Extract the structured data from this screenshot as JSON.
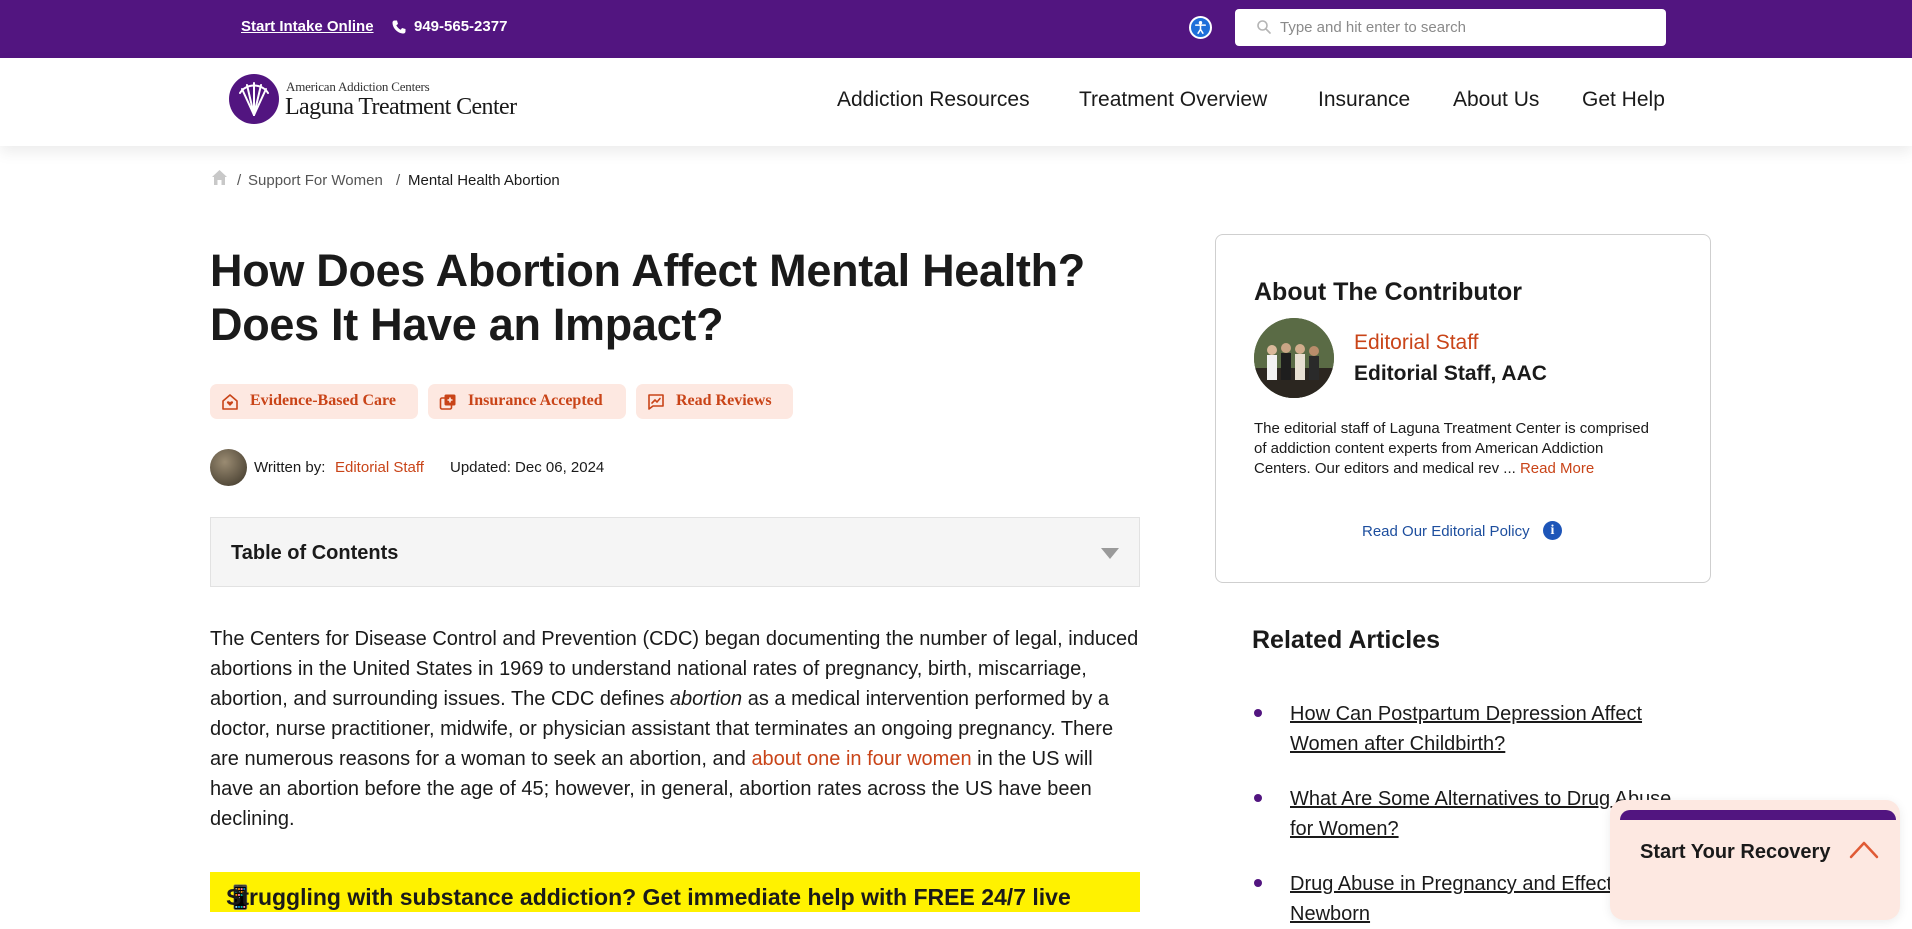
{
  "topbar": {
    "intake_label": "Start Intake Online",
    "phone": "949-565-2377",
    "search_placeholder": "Type and hit enter to search",
    "bg_color": "#521580"
  },
  "header": {
    "logo_top": "American Addiction Centers",
    "logo_main": "Laguna Treatment Center",
    "nav": [
      "Addiction Resources",
      "Treatment Overview",
      "Insurance",
      "About Us",
      "Get Help"
    ]
  },
  "breadcrumb": {
    "items": [
      "Support For Women",
      "Mental Health Abortion"
    ],
    "separator": "/"
  },
  "article": {
    "title_line1": "How Does Abortion Affect Mental Health?",
    "title_line2": "Does It Have an Impact?",
    "badges": [
      "Evidence-Based Care",
      "Insurance Accepted",
      "Read Reviews"
    ],
    "written_by_label": "Written by:",
    "author": "Editorial Staff",
    "updated": "Updated: Dec 06, 2024",
    "toc_title": "Table of Contents",
    "para_1": "The Centers for Disease Control and Prevention (CDC) began documenting the number of legal, induced abortions in the United States in 1969 to understand national rates of pregnancy, birth, miscarriage, abortion, and surrounding issues. The CDC defines ",
    "para_italic": "abortion",
    "para_2": " as a medical intervention performed by a doctor, nurse practitioner, midwife, or physician assistant that terminates an ongoing pregnancy. There are numerous reasons for a woman to seek an abortion, and ",
    "para_link": "about one in four women",
    "para_3": " in the US will have an abortion before the age of 45; however, in general, abortion rates across the US have been declining.",
    "callout": "Struggling with substance addiction? Get immediate help with FREE 24/7 live"
  },
  "contributor": {
    "title": "About The Contributor",
    "name": "Editorial Staff",
    "org": "Editorial Staff, AAC",
    "description": "The editorial staff of Laguna Treatment Center is comprised of addiction content experts from American Addiction Centers. Our editors and medical rev ... ",
    "read_more": "Read More",
    "policy": "Read Our Editorial Policy",
    "policy_icon": "i"
  },
  "related": {
    "title": "Related Articles",
    "items": [
      "How Can Postpartum Depression Affect Women after Childbirth?",
      "What Are Some Alternatives to Drug Abuse for Women?",
      "Drug Abuse in Pregnancy and Effects on the Newborn"
    ]
  },
  "cta": {
    "label": "Start Your Recovery"
  },
  "colors": {
    "accent": "#c94418",
    "brand_purple": "#521580",
    "badge_bg": "#fde8e1",
    "callout_bg": "#fff200",
    "policy_blue": "#1d4e9e"
  }
}
